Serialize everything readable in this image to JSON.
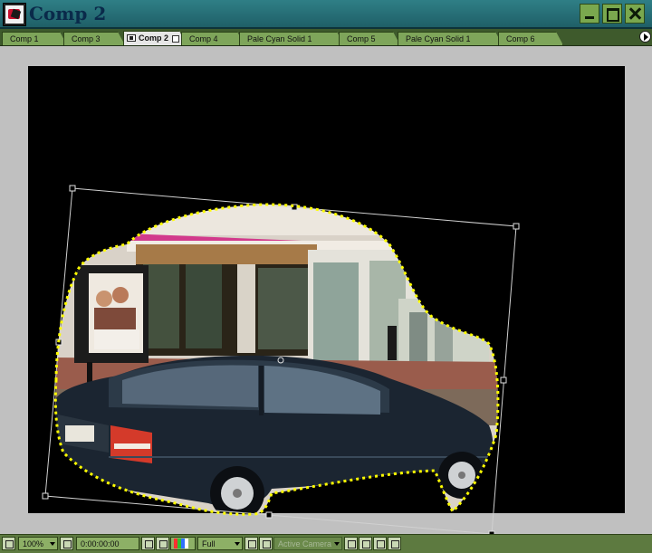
{
  "window": {
    "title": "Comp 2"
  },
  "tabs": [
    {
      "label": "Comp 1",
      "active": false
    },
    {
      "label": "Comp 3",
      "active": false
    },
    {
      "label": "Comp 2",
      "active": true
    },
    {
      "label": "Comp 4",
      "active": false
    },
    {
      "label": "Pale Cyan Solid 1",
      "active": false
    },
    {
      "label": "Comp 5",
      "active": false
    },
    {
      "label": "Pale Cyan Solid 1",
      "active": false
    },
    {
      "label": "Comp 6",
      "active": false
    }
  ],
  "viewer": {
    "background": "#000000",
    "mask_color": "#ffff00",
    "bbox_color": "#d0d0d0"
  },
  "bottom_bar": {
    "zoom": "100%",
    "timecode": "0:00:00:00",
    "resolution": "Full",
    "camera": "Active Camera",
    "channel_colors": [
      "#ff3030",
      "#30c030",
      "#3070ff",
      "#ffffff"
    ],
    "icons": [
      "grid-icon",
      "snapshot-icon",
      "channel-icon",
      "region-icon",
      "transparency-icon",
      "draft-3d-icon",
      "flowchart-icon"
    ]
  }
}
